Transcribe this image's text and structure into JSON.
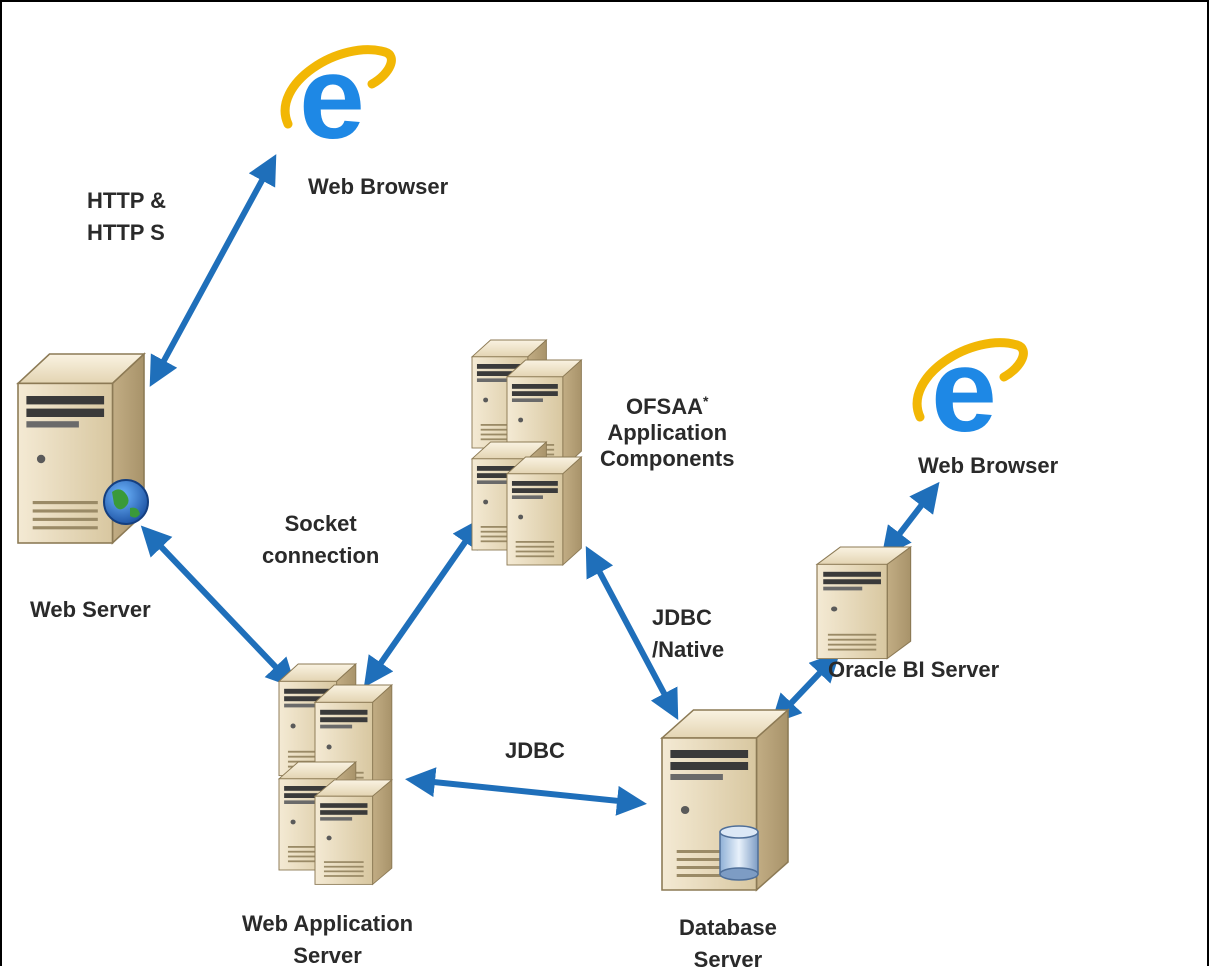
{
  "labels": {
    "web_browser_top": "Web Browser",
    "http_line1": "HTTP &",
    "http_line2": "HTTP S",
    "web_server": "Web Server",
    "socket_line1": "Socket",
    "socket_line2": "connection",
    "ofsaa_line1": "OFSAA",
    "ofsaa_asterisk": "*",
    "ofsaa_line2": "Application",
    "ofsaa_line3": "Components",
    "web_browser_right": "Web Browser",
    "jdbc_native_line1": "JDBC",
    "jdbc_native_line2": "/Native",
    "oracle_bi": "Oracle BI Server",
    "jdbc": "JDBC",
    "web_app_line1": "Web Application",
    "web_app_line2": "Server",
    "database_line1": "Database",
    "database_line2": "Server"
  },
  "icons": {
    "browser": "internet-explorer-icon",
    "server": "server-tower-icon",
    "globe": "globe-icon",
    "database": "database-cylinder-icon"
  },
  "colors": {
    "arrow": "#1f6fba",
    "server_front": "#e9dcc0",
    "server_side": "#c9b58e",
    "browser_blue": "#1e88e5",
    "browser_ring": "#f2b705"
  }
}
